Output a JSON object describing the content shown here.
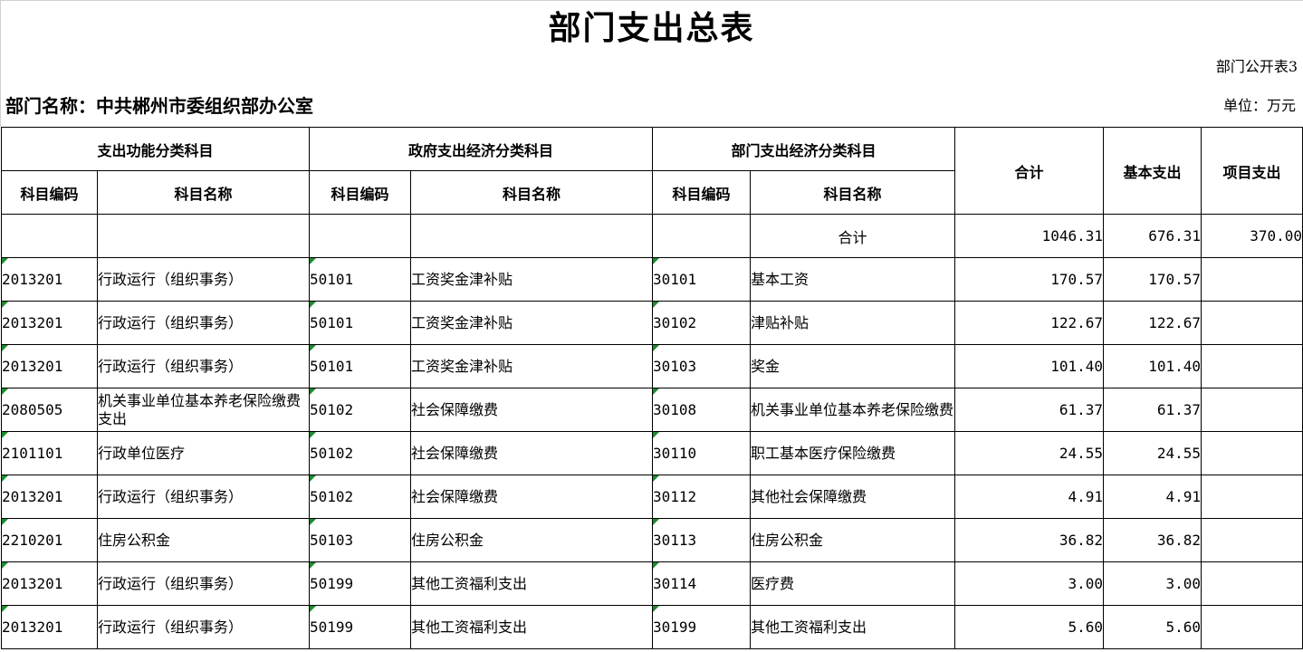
{
  "title": "部门支出总表",
  "form_no": "部门公开表3",
  "dept_label": "部门名称：中共郴州市委组织部办公室",
  "unit_label": "单位：万元",
  "headers": {
    "group_func": "支出功能分类科目",
    "group_gov": "政府支出经济分类科目",
    "group_dept": "部门支出经济分类科目",
    "total": "合计",
    "basic": "基本支出",
    "project": "项目支出",
    "code": "科目编码",
    "name": "科目名称"
  },
  "total_row": {
    "label": "合计",
    "total": "1046.31",
    "basic": "676.31",
    "project": "370.00"
  },
  "rows": [
    {
      "func_code": "2013201",
      "func_name": "行政运行（组织事务）",
      "gov_code": "50101",
      "gov_name": "工资奖金津补贴",
      "dept_code": "30101",
      "dept_name": "基本工资",
      "total": "170.57",
      "basic": "170.57",
      "project": ""
    },
    {
      "func_code": "2013201",
      "func_name": "行政运行（组织事务）",
      "gov_code": "50101",
      "gov_name": "工资奖金津补贴",
      "dept_code": "30102",
      "dept_name": "津贴补贴",
      "total": "122.67",
      "basic": "122.67",
      "project": ""
    },
    {
      "func_code": "2013201",
      "func_name": "行政运行（组织事务）",
      "gov_code": "50101",
      "gov_name": "工资奖金津补贴",
      "dept_code": "30103",
      "dept_name": "奖金",
      "total": "101.40",
      "basic": "101.40",
      "project": ""
    },
    {
      "func_code": "2080505",
      "func_name": "机关事业单位基本养老保险缴费支出",
      "gov_code": "50102",
      "gov_name": "社会保障缴费",
      "dept_code": "30108",
      "dept_name": "机关事业单位基本养老保险缴费",
      "total": "61.37",
      "basic": "61.37",
      "project": ""
    },
    {
      "func_code": "2101101",
      "func_name": "行政单位医疗",
      "gov_code": "50102",
      "gov_name": "社会保障缴费",
      "dept_code": "30110",
      "dept_name": "职工基本医疗保险缴费",
      "total": "24.55",
      "basic": "24.55",
      "project": ""
    },
    {
      "func_code": "2013201",
      "func_name": "行政运行（组织事务）",
      "gov_code": "50102",
      "gov_name": "社会保障缴费",
      "dept_code": "30112",
      "dept_name": "其他社会保障缴费",
      "total": "4.91",
      "basic": "4.91",
      "project": ""
    },
    {
      "func_code": "2210201",
      "func_name": "住房公积金",
      "gov_code": "50103",
      "gov_name": "住房公积金",
      "dept_code": "30113",
      "dept_name": "住房公积金",
      "total": "36.82",
      "basic": "36.82",
      "project": ""
    },
    {
      "func_code": "2013201",
      "func_name": "行政运行（组织事务）",
      "gov_code": "50199",
      "gov_name": "其他工资福利支出",
      "dept_code": "30114",
      "dept_name": "医疗费",
      "total": "3.00",
      "basic": "3.00",
      "project": ""
    },
    {
      "func_code": "2013201",
      "func_name": "行政运行（组织事务）",
      "gov_code": "50199",
      "gov_name": "其他工资福利支出",
      "dept_code": "30199",
      "dept_name": "其他工资福利支出",
      "total": "5.60",
      "basic": "5.60",
      "project": ""
    }
  ]
}
